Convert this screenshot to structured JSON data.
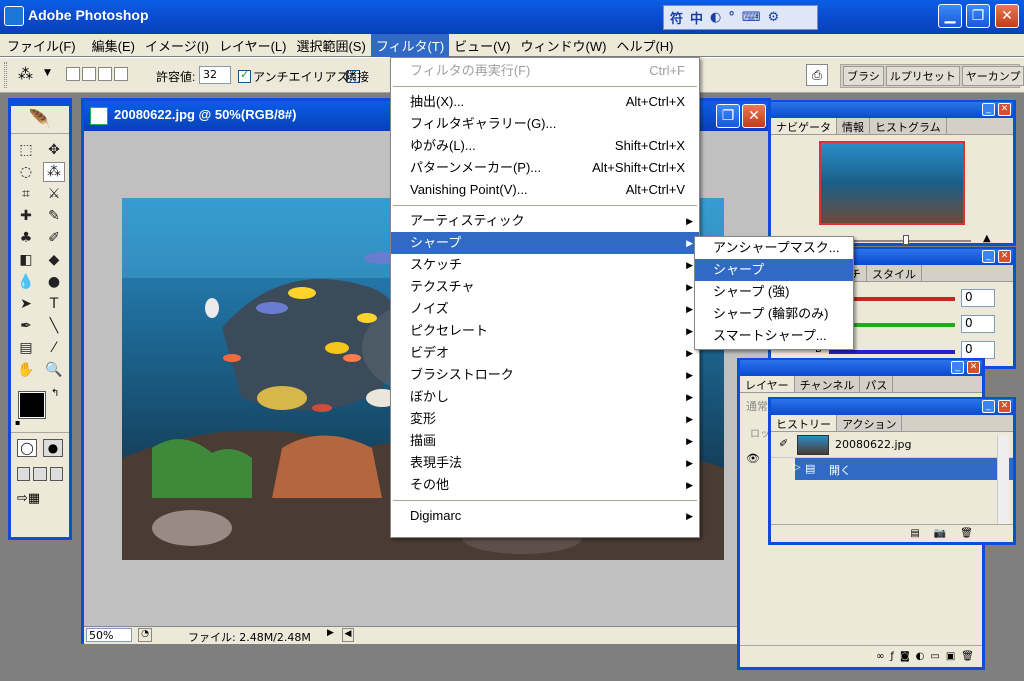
{
  "app": {
    "title": "Adobe Photoshop"
  },
  "menubar": [
    {
      "label": "ファイル(F)"
    },
    {
      "label": "編集(E)"
    },
    {
      "label": "イメージ(I)"
    },
    {
      "label": "レイヤー(L)"
    },
    {
      "label": "選択範囲(S)"
    },
    {
      "label": "フィルタ(T)"
    },
    {
      "label": "ビュー(V)"
    },
    {
      "label": "ウィンドウ(W)"
    },
    {
      "label": "ヘルプ(H)"
    }
  ],
  "options": {
    "tolerance_label": "許容値:",
    "tolerance_value": "32",
    "antialias_label": "アンチエイリアス",
    "contiguous_label": "隣接"
  },
  "palette_well": {
    "tabs": [
      "ブラシ",
      "ルプリセット",
      "ヤーカンプ"
    ]
  },
  "document": {
    "title": "20080622.jpg @ 50%(RGB/8#)",
    "zoom": "50%",
    "file_info": "ファイル: 2.48M/2.48M"
  },
  "filter_menu": {
    "last_filter": {
      "label": "フィルタの再実行(F)",
      "shortcut": "Ctrl+F"
    },
    "group1": [
      {
        "label": "抽出(X)...",
        "shortcut": "Alt+Ctrl+X"
      },
      {
        "label": "フィルタギャラリー(G)...",
        "shortcut": ""
      },
      {
        "label": "ゆがみ(L)...",
        "shortcut": "Shift+Ctrl+X"
      },
      {
        "label": "パターンメーカー(P)...",
        "shortcut": "Alt+Shift+Ctrl+X"
      },
      {
        "label": "Vanishing Point(V)...",
        "shortcut": "Alt+Ctrl+V"
      }
    ],
    "group2": [
      "アーティスティック",
      "シャープ",
      "スケッチ",
      "テクスチャ",
      "ノイズ",
      "ピクセレート",
      "ビデオ",
      "ブラシストローク",
      "ぼかし",
      "変形",
      "描画",
      "表現手法",
      "その他"
    ],
    "highlighted": "シャープ",
    "group3": [
      "Digimarc"
    ]
  },
  "sharpen_submenu": {
    "items": [
      "アンシャープマスク...",
      "シャープ",
      "シャープ (強)",
      "シャープ (輪郭のみ)",
      "スマートシャープ..."
    ],
    "highlighted": "シャープ"
  },
  "navigator_palette": {
    "tabs": [
      "ナビゲータ",
      "情報",
      "ヒストグラム"
    ]
  },
  "color_palette": {
    "tabs": [
      "チ",
      "スタイル"
    ],
    "values": [
      "0",
      "0",
      "0"
    ],
    "b_label": "B"
  },
  "layers_palette": {
    "tabs": [
      "レイヤー",
      "チャンネル",
      "パス"
    ],
    "blend": "通常",
    "lock": "ロック"
  },
  "history_palette": {
    "tabs": [
      "ヒストリー",
      "アクション"
    ],
    "snapshot": "20080622.jpg",
    "states": [
      "開く"
    ]
  },
  "colors": {
    "xp_blue": "#0b4fd4",
    "menu_highlight": "#316ac5",
    "chrome": "#ece9d8"
  }
}
